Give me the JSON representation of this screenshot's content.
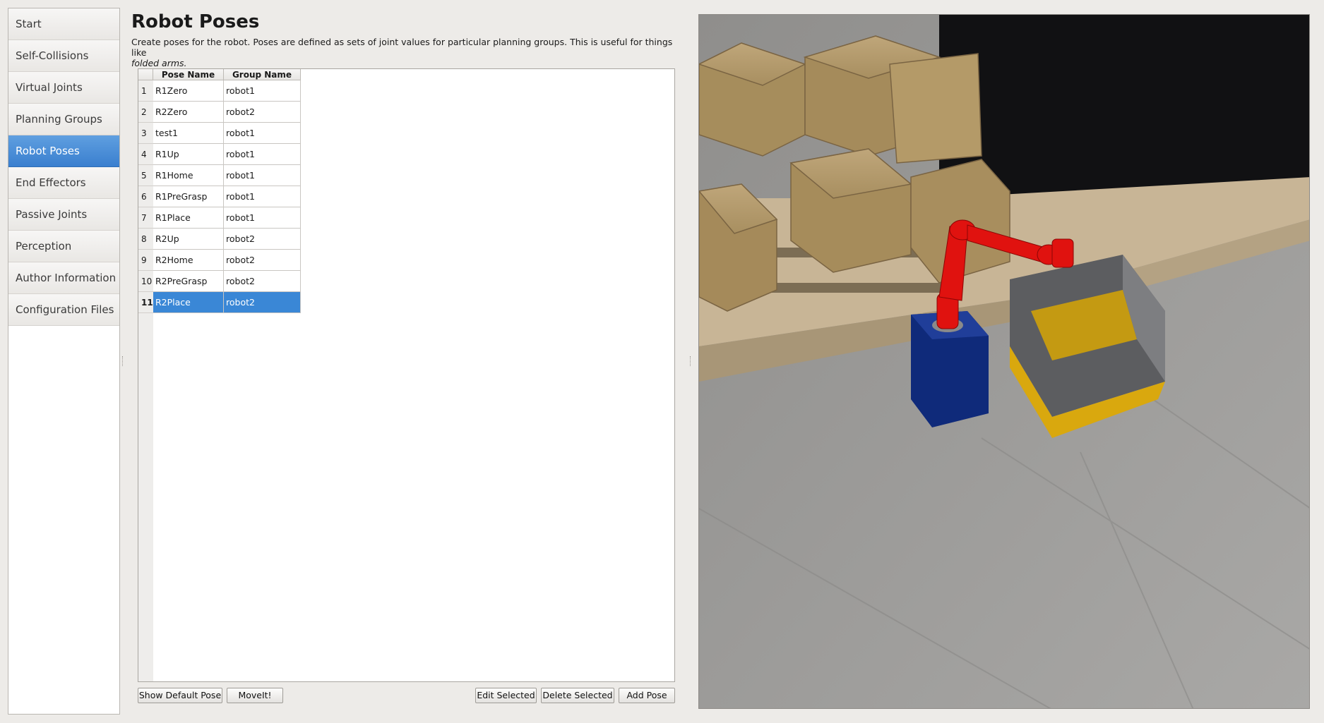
{
  "sidebar": {
    "items": [
      {
        "label": "Start"
      },
      {
        "label": "Self-Collisions"
      },
      {
        "label": "Virtual Joints"
      },
      {
        "label": "Planning Groups"
      },
      {
        "label": "Robot Poses"
      },
      {
        "label": "End Effectors"
      },
      {
        "label": "Passive Joints"
      },
      {
        "label": "Perception"
      },
      {
        "label": "Author Information"
      },
      {
        "label": "Configuration Files"
      }
    ],
    "active_index": 4
  },
  "page": {
    "title": "Robot Poses",
    "description": "Create poses for the robot. Poses are defined as sets of joint values for particular planning groups. This is useful for things like",
    "description_italic": "folded arms."
  },
  "table": {
    "columns": [
      "Pose Name",
      "Group Name"
    ],
    "rows": [
      {
        "num": "1",
        "pose": "R1Zero",
        "group": "robot1"
      },
      {
        "num": "2",
        "pose": "R2Zero",
        "group": "robot2"
      },
      {
        "num": "3",
        "pose": "test1",
        "group": "robot1"
      },
      {
        "num": "4",
        "pose": "R1Up",
        "group": "robot1"
      },
      {
        "num": "5",
        "pose": "R1Home",
        "group": "robot1"
      },
      {
        "num": "6",
        "pose": "R1PreGrasp",
        "group": "robot1"
      },
      {
        "num": "7",
        "pose": "R1Place",
        "group": "robot1"
      },
      {
        "num": "8",
        "pose": "R2Up",
        "group": "robot2"
      },
      {
        "num": "9",
        "pose": "R2Home",
        "group": "robot2"
      },
      {
        "num": "10",
        "pose": "R2PreGrasp",
        "group": "robot2"
      },
      {
        "num": "11",
        "pose": "R2Place",
        "group": "robot2"
      }
    ],
    "selected_index": 10
  },
  "buttons": {
    "show_default_pose": "Show Default Pose",
    "moveit": "MoveIt!",
    "edit_selected": "Edit Selected",
    "delete_selected": "Delete Selected",
    "add_pose": "Add Pose"
  },
  "colors": {
    "selection": "#3a87d6",
    "robot_arm": "#e0120f",
    "robot_base": "#0f2a7a",
    "bin_tray": "#d9a80e"
  }
}
